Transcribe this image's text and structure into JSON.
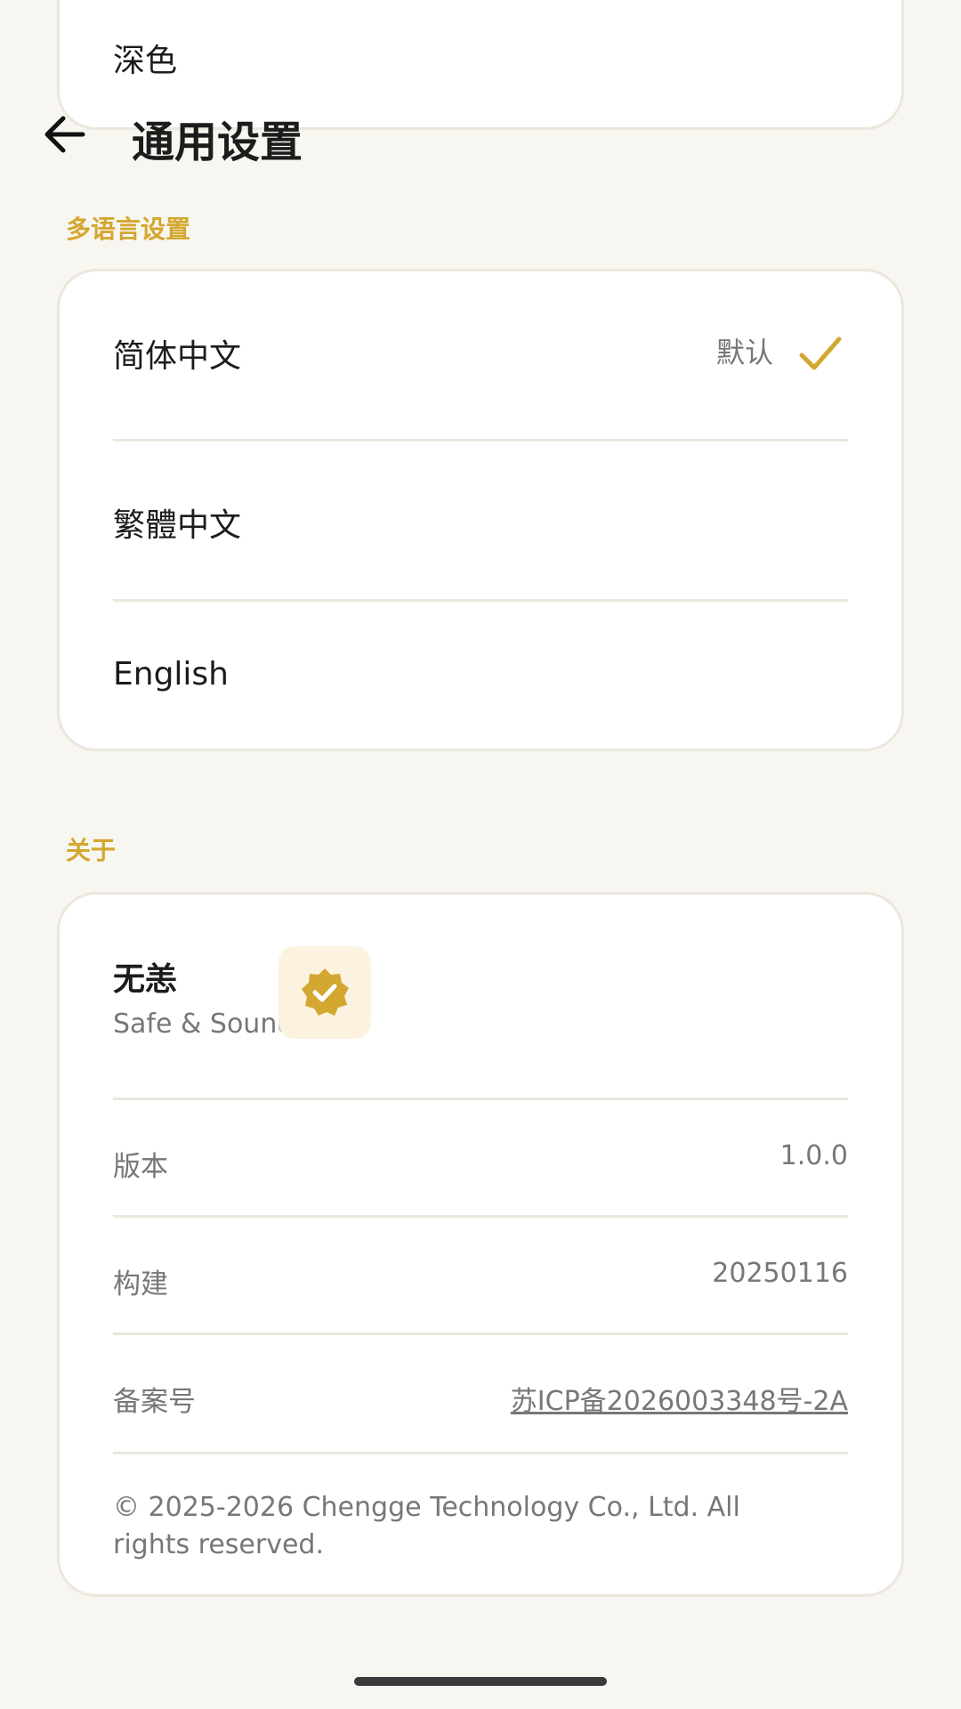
{
  "top_card": {
    "label": "深色"
  },
  "header": {
    "title": "通用设置",
    "back_icon": "arrow-left-icon"
  },
  "language_section": {
    "label": "多语言设置",
    "items": [
      {
        "label": "简体中文",
        "tag": "默认",
        "selected": true
      },
      {
        "label": "繁體中文",
        "selected": false
      },
      {
        "label": "English",
        "selected": false
      }
    ]
  },
  "about_section": {
    "label": "关于",
    "app_name": "无恙",
    "app_subtitle": "Safe & Sound",
    "badge_icon": "verified-badge-icon",
    "rows": [
      {
        "label": "版本",
        "value": "1.0.0"
      },
      {
        "label": "构建",
        "value": "20250116"
      },
      {
        "label": "备案号",
        "value": "苏ICP备2026003348号-2A"
      }
    ],
    "copyright": "© 2025-2026 Chengge Technology Co., Ltd. All rights reserved."
  },
  "colors": {
    "accent": "#d3a730",
    "background": "#f8f6f0",
    "card": "#ffffff"
  }
}
